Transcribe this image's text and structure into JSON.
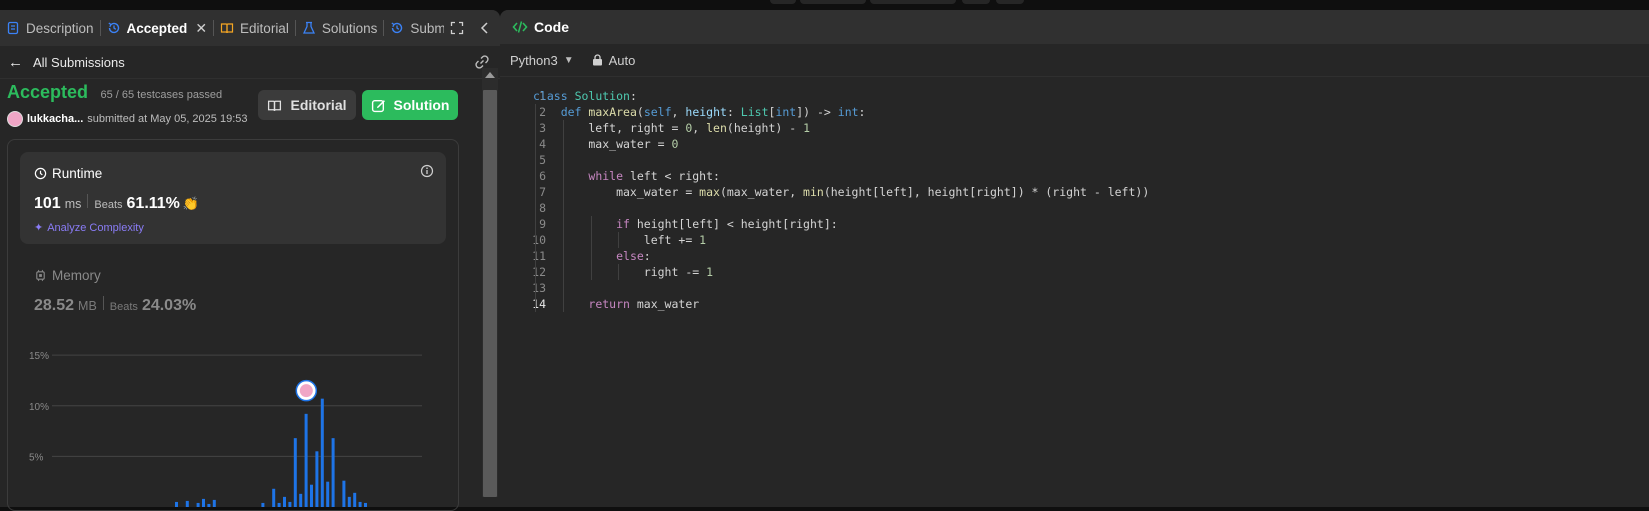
{
  "tabs": [
    {
      "label": "Description",
      "icon": "description-icon",
      "active": false
    },
    {
      "label": "Accepted",
      "icon": "history-icon",
      "active": true
    },
    {
      "label": "Editorial",
      "icon": "book-icon",
      "active": false
    },
    {
      "label": "Solutions",
      "icon": "flask-icon",
      "active": false
    },
    {
      "label": "Submis",
      "icon": "history-icon",
      "active": false
    }
  ],
  "subheader": {
    "back_label": "All Submissions"
  },
  "result": {
    "status": "Accepted",
    "testcases": "65 / 65 testcases passed",
    "user": "lukkacha...",
    "submitted": "submitted at May 05, 2025 19:53",
    "status_color": "#2cbb5d"
  },
  "buttons": {
    "editorial": "Editorial",
    "solution": "Solution"
  },
  "runtime": {
    "title": "Runtime",
    "value": "101",
    "unit": "ms",
    "beats_label": "Beats",
    "beats": "61.11%",
    "analyze": "Analyze Complexity"
  },
  "memory": {
    "title": "Memory",
    "value": "28.52",
    "unit": "MB",
    "beats_label": "Beats",
    "beats": "24.03%"
  },
  "chart_data": {
    "type": "bar",
    "ytick_labels": [
      "15%",
      "10%",
      "5%"
    ],
    "yticks": [
      15,
      10,
      5
    ],
    "ylim": [
      0,
      16
    ],
    "grid": true,
    "values": [
      0.5,
      0,
      0.6,
      0,
      0.4,
      0.8,
      0.3,
      0.7,
      0,
      0,
      0,
      0,
      0,
      0,
      0,
      0,
      0.4,
      0,
      1.8,
      0.4,
      1,
      0.5,
      6.8,
      1.3,
      9.2,
      2.2,
      5.5,
      10.7,
      2.5,
      6.8,
      0,
      2.6,
      1,
      1.4,
      0.5,
      0.4
    ],
    "highlight_index": 27,
    "bar_color": "#1e74e7"
  },
  "code_panel": {
    "title": "Code",
    "language": "Python3",
    "auto_label": "Auto",
    "active_line": 14,
    "lines": [
      "class Solution:",
      "    def maxArea(self, height: List[int]) -> int:",
      "        left, right = 0, len(height) - 1",
      "        max_water = 0",
      "",
      "        while left < right:",
      "            max_water = max(max_water, min(height[left], height[right]) * (right - left))",
      "",
      "            if height[left] < height[right]:",
      "                left += 1",
      "            else:",
      "                right -= 1",
      "",
      "        return max_water"
    ]
  }
}
